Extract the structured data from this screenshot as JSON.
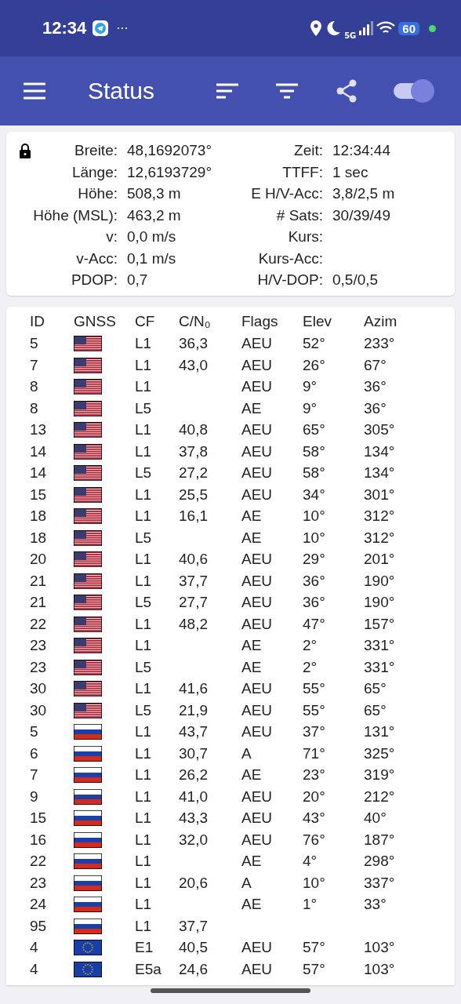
{
  "status_bar": {
    "time": "12:34",
    "more": "···",
    "network": "5G",
    "battery": "60"
  },
  "app_bar": {
    "title": "Status",
    "toggle": {
      "on": true
    }
  },
  "fix": {
    "locked": true,
    "left": [
      {
        "label": "Breite:",
        "value": "48,1692073°"
      },
      {
        "label": "Länge:",
        "value": "12,6193729°"
      },
      {
        "label": "Höhe:",
        "value": "508,3 m"
      },
      {
        "label": "Höhe (MSL):",
        "value": "463,2 m"
      },
      {
        "label": "v:",
        "value": "0,0 m/s"
      },
      {
        "label": "v-Acc:",
        "value": "0,1 m/s"
      },
      {
        "label": "PDOP:",
        "value": "0,7"
      }
    ],
    "right": [
      {
        "label": "Zeit:",
        "value": "12:34:44"
      },
      {
        "label": "TTFF:",
        "value": "1 sec"
      },
      {
        "label": "E H/V-Acc:",
        "value": "3,8/2,5 m"
      },
      {
        "label": "# Sats:",
        "value": "30/39/49"
      },
      {
        "label": "Kurs:"
      },
      {
        "label": "Kurs-Acc:"
      },
      {
        "label": "H/V-DOP:",
        "value": "0,5/0,5"
      }
    ]
  },
  "table": {
    "columns": [
      "ID",
      "GNSS",
      "CF",
      "C/N₀",
      "Flags",
      "Elev",
      "Azim"
    ],
    "rows": [
      {
        "id": "5",
        "kind": "us",
        "cf": "L1",
        "cn0": "36,3",
        "flags": "AEU",
        "elev": "52°",
        "azim": "233°"
      },
      {
        "id": "7",
        "kind": "us",
        "cf": "L1",
        "cn0": "43,0",
        "flags": "AEU",
        "elev": "26°",
        "azim": "67°"
      },
      {
        "id": "8",
        "kind": "us",
        "cf": "L1",
        "flags": "AEU",
        "elev": "9°",
        "azim": "36°"
      },
      {
        "id": "8",
        "kind": "us",
        "cf": "L5",
        "flags": "AE",
        "elev": "9°",
        "azim": "36°"
      },
      {
        "id": "13",
        "kind": "us",
        "cf": "L1",
        "cn0": "40,8",
        "flags": "AEU",
        "elev": "65°",
        "azim": "305°"
      },
      {
        "id": "14",
        "kind": "us",
        "cf": "L1",
        "cn0": "37,8",
        "flags": "AEU",
        "elev": "58°",
        "azim": "134°"
      },
      {
        "id": "14",
        "kind": "us",
        "cf": "L5",
        "cn0": "27,2",
        "flags": "AEU",
        "elev": "58°",
        "azim": "134°"
      },
      {
        "id": "15",
        "kind": "us",
        "cf": "L1",
        "cn0": "25,5",
        "flags": "AEU",
        "elev": "34°",
        "azim": "301°"
      },
      {
        "id": "18",
        "kind": "us",
        "cf": "L1",
        "cn0": "16,1",
        "flags": "AE",
        "elev": "10°",
        "azim": "312°"
      },
      {
        "id": "18",
        "kind": "us",
        "cf": "L5",
        "flags": "AE",
        "elev": "10°",
        "azim": "312°"
      },
      {
        "id": "20",
        "kind": "us",
        "cf": "L1",
        "cn0": "40,6",
        "flags": "AEU",
        "elev": "29°",
        "azim": "201°"
      },
      {
        "id": "21",
        "kind": "us",
        "cf": "L1",
        "cn0": "37,7",
        "flags": "AEU",
        "elev": "36°",
        "azim": "190°"
      },
      {
        "id": "21",
        "kind": "us",
        "cf": "L5",
        "cn0": "27,7",
        "flags": "AEU",
        "elev": "36°",
        "azim": "190°"
      },
      {
        "id": "22",
        "kind": "us",
        "cf": "L1",
        "cn0": "48,2",
        "flags": "AEU",
        "elev": "47°",
        "azim": "157°"
      },
      {
        "id": "23",
        "kind": "us",
        "cf": "L1",
        "flags": "AE",
        "elev": "2°",
        "azim": "331°"
      },
      {
        "id": "23",
        "kind": "us",
        "cf": "L5",
        "flags": "AE",
        "elev": "2°",
        "azim": "331°"
      },
      {
        "id": "30",
        "kind": "us",
        "cf": "L1",
        "cn0": "41,6",
        "flags": "AEU",
        "elev": "55°",
        "azim": "65°"
      },
      {
        "id": "30",
        "kind": "us",
        "cf": "L5",
        "cn0": "21,9",
        "flags": "AEU",
        "elev": "55°",
        "azim": "65°"
      },
      {
        "id": "5",
        "kind": "ru",
        "cf": "L1",
        "cn0": "43,7",
        "flags": "AEU",
        "elev": "37°",
        "azim": "131°"
      },
      {
        "id": "6",
        "kind": "ru",
        "cf": "L1",
        "cn0": "30,7",
        "flags": "A",
        "elev": "71°",
        "azim": "325°"
      },
      {
        "id": "7",
        "kind": "ru",
        "cf": "L1",
        "cn0": "26,2",
        "flags": "AE",
        "elev": "23°",
        "azim": "319°"
      },
      {
        "id": "9",
        "kind": "ru",
        "cf": "L1",
        "cn0": "41,0",
        "flags": "AEU",
        "elev": "20°",
        "azim": "212°"
      },
      {
        "id": "15",
        "kind": "ru",
        "cf": "L1",
        "cn0": "43,3",
        "flags": "AEU",
        "elev": "43°",
        "azim": "40°"
      },
      {
        "id": "16",
        "kind": "ru",
        "cf": "L1",
        "cn0": "32,0",
        "flags": "AEU",
        "elev": "76°",
        "azim": "187°"
      },
      {
        "id": "22",
        "kind": "ru",
        "cf": "L1",
        "flags": "AE",
        "elev": "4°",
        "azim": "298°"
      },
      {
        "id": "23",
        "kind": "ru",
        "cf": "L1",
        "cn0": "20,6",
        "flags": "A",
        "elev": "10°",
        "azim": "337°"
      },
      {
        "id": "24",
        "kind": "ru",
        "cf": "L1",
        "flags": "AE",
        "elev": "1°",
        "azim": "33°"
      },
      {
        "id": "95",
        "kind": "ru",
        "cf": "L1",
        "cn0": "37,7"
      },
      {
        "id": "4",
        "kind": "eu",
        "cf": "E1",
        "cn0": "40,5",
        "flags": "AEU",
        "elev": "57°",
        "azim": "103°"
      },
      {
        "id": "4",
        "kind": "eu",
        "cf": "E5a",
        "cn0": "24,6",
        "flags": "AEU",
        "elev": "57°",
        "azim": "103°"
      }
    ]
  }
}
